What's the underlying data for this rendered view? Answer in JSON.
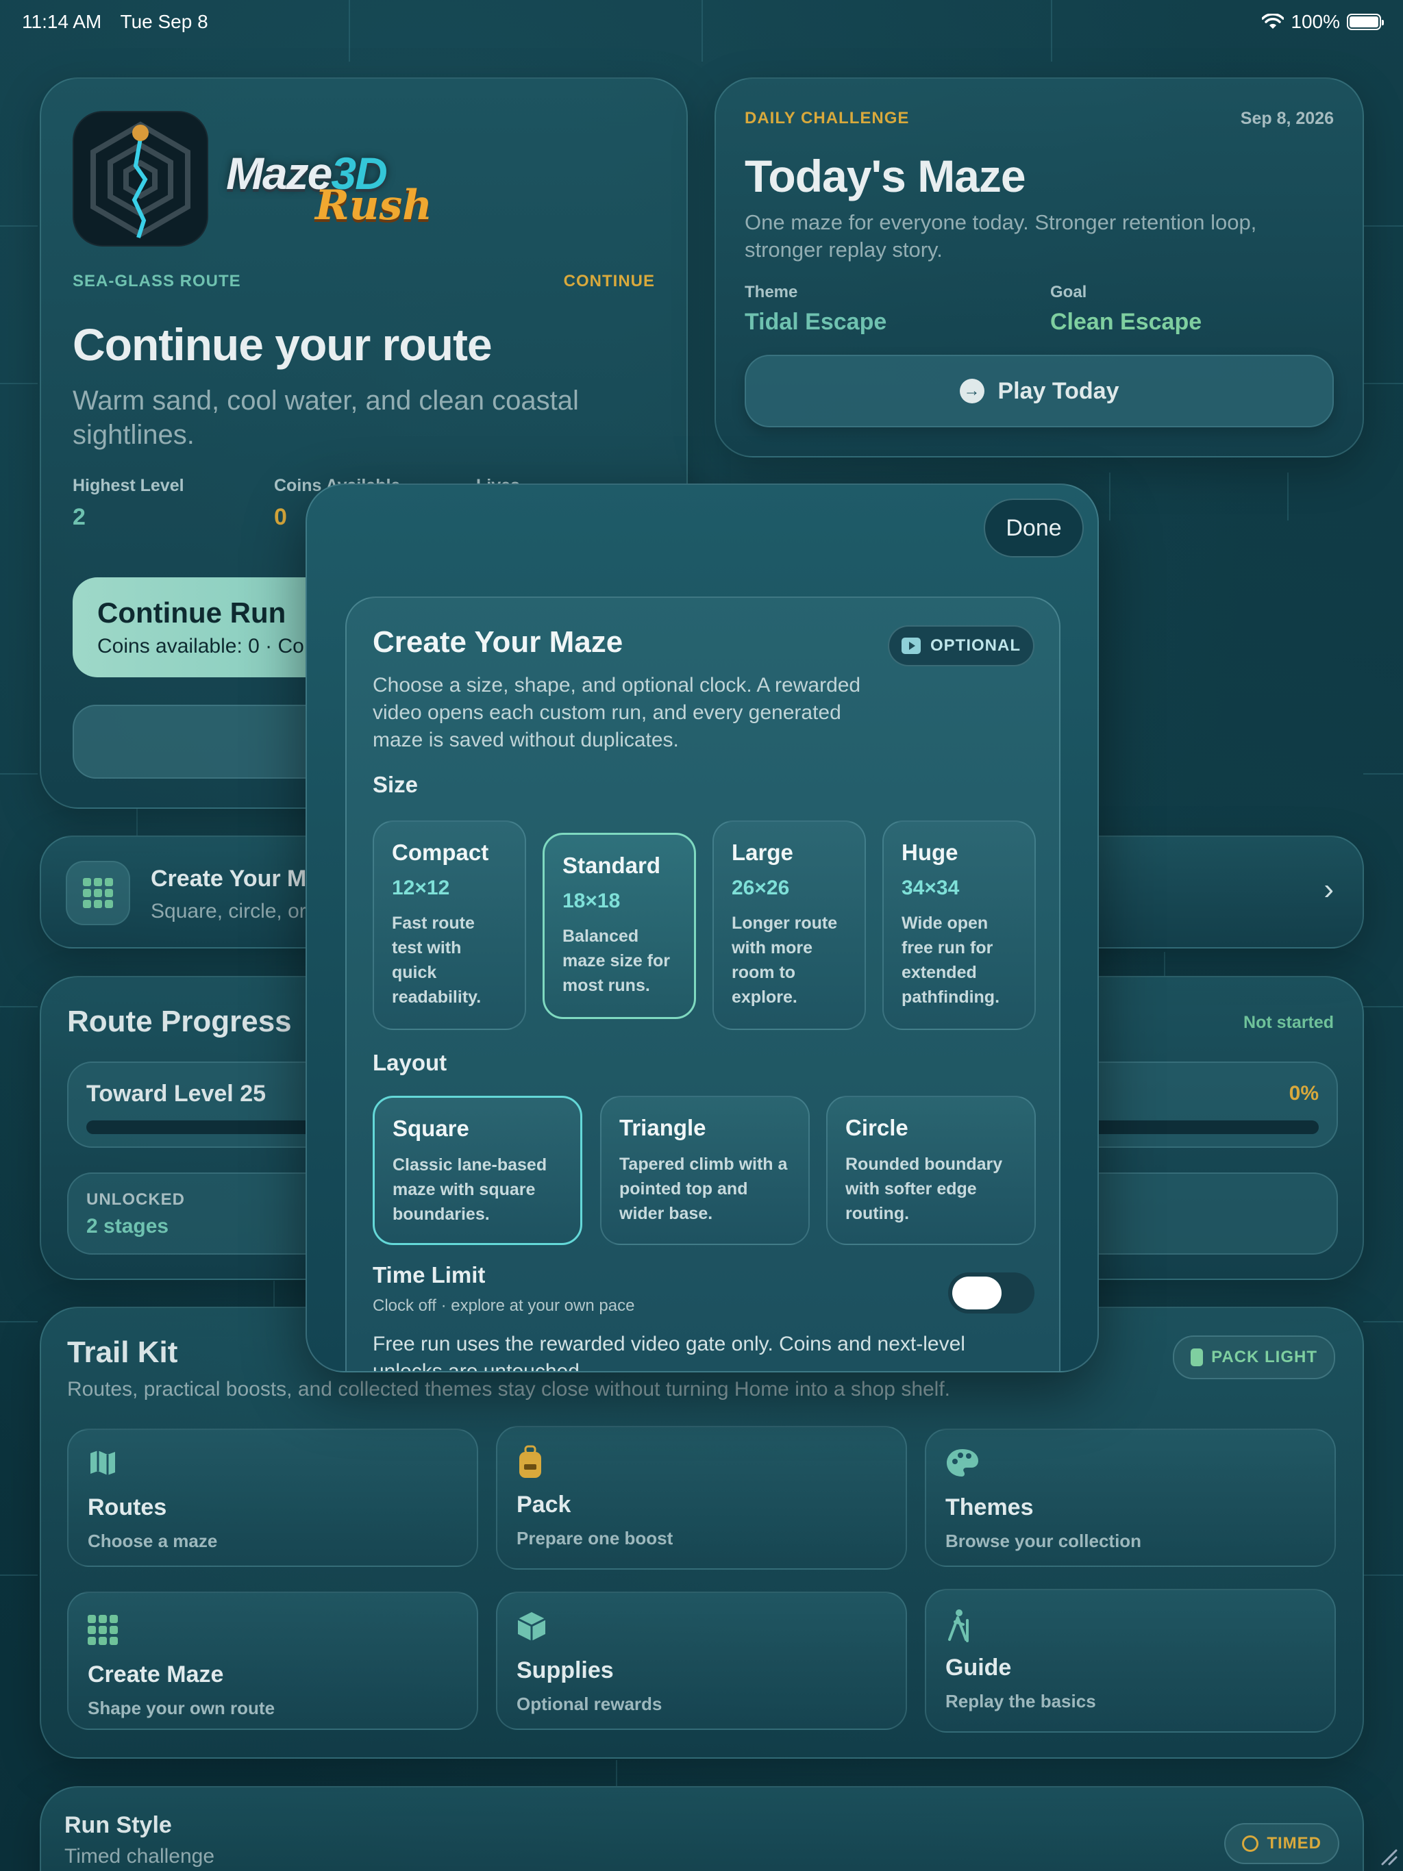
{
  "status": {
    "time": "11:14 AM",
    "date": "Tue Sep 8",
    "battery": "100%"
  },
  "continue_card": {
    "logo": {
      "maze": "Maze",
      "three_d": "3D",
      "rush": "Rush"
    },
    "route_name": "SEA-GLASS ROUTE",
    "continue_label": "CONTINUE",
    "title": "Continue your route",
    "subtitle": "Warm sand, cool water, and clean coastal sightlines.",
    "stats": [
      {
        "label": "Highest Level",
        "value": "2"
      },
      {
        "label": "Coins Available",
        "value": "0"
      },
      {
        "label": "Lives",
        "value": ""
      }
    ],
    "primary_button": {
      "title": "Continue Run",
      "subtitle": "Coins available: 0 · Co"
    }
  },
  "daily_card": {
    "eyebrow": "DAILY CHALLENGE",
    "date": "Sep 8, 2026",
    "title": "Today's Maze",
    "description": "One maze for everyone today. Stronger retention loop, stronger replay story.",
    "theme_label": "Theme",
    "theme_value": "Tidal Escape",
    "goal_label": "Goal",
    "goal_value": "Clean Escape",
    "play_button": "Play Today"
  },
  "create_row": {
    "title": "Create Your M",
    "subtitle": "Square, circle, or"
  },
  "route_progress": {
    "title": "Route Progress",
    "status": "Not started",
    "toward_label": "Toward Level 25",
    "percent": "0%",
    "progress": 0,
    "unlocked_label": "UNLOCKED",
    "unlocked_value": "2 stages"
  },
  "trail_kit": {
    "title": "Trail Kit",
    "subtitle": "Routes, practical boosts, and collected themes stay close without turning Home into a shop shelf.",
    "pill": "PACK LIGHT",
    "tiles": [
      {
        "title": "Routes",
        "subtitle": "Choose a maze",
        "icon": "map-icon"
      },
      {
        "title": "Pack",
        "subtitle": "Prepare one boost",
        "icon": "backpack-icon"
      },
      {
        "title": "Themes",
        "subtitle": "Browse your collection",
        "icon": "palette-icon"
      },
      {
        "title": "Create Maze",
        "subtitle": "Shape your own route",
        "icon": "grid-icon"
      },
      {
        "title": "Supplies",
        "subtitle": "Optional rewards",
        "icon": "cube-icon"
      },
      {
        "title": "Guide",
        "subtitle": "Replay the basics",
        "icon": "hiker-icon"
      }
    ]
  },
  "run_style": {
    "title": "Run Style",
    "subtitle": "Timed challenge",
    "pill": "TIMED"
  },
  "sheet": {
    "done": "Done",
    "title": "Create Your Maze",
    "optional": "OPTIONAL",
    "description": "Choose a size, shape, and optional clock. A rewarded video opens each custom run, and every generated maze is saved without duplicates.",
    "size_title": "Size",
    "sizes": [
      {
        "title": "Compact",
        "dims": "12×12",
        "desc": "Fast route test with quick readability."
      },
      {
        "title": "Standard",
        "dims": "18×18",
        "desc": "Balanced maze size for most runs."
      },
      {
        "title": "Large",
        "dims": "26×26",
        "desc": "Longer route with more room to explore."
      },
      {
        "title": "Huge",
        "dims": "34×34",
        "desc": "Wide open free run for extended pathfinding."
      }
    ],
    "selected_size": "Standard",
    "layout_title": "Layout",
    "layouts": [
      {
        "title": "Square",
        "desc": "Classic lane-based maze with square boundaries."
      },
      {
        "title": "Triangle",
        "desc": "Tapered climb with a pointed top and wider base."
      },
      {
        "title": "Circle",
        "desc": "Rounded boundary with softer edge routing."
      }
    ],
    "selected_layout": "Square",
    "time_title": "Time Limit",
    "time_sub": "Clock off · explore at your own pace",
    "time_enabled": false,
    "footer": "Free run uses the rewarded video gate only. Coins and next-level unlocks are untouched."
  },
  "colors": {
    "accent_gold": "#d9a93c",
    "accent_teal": "#6fc2b0",
    "accent_cyan": "#7fe0d8"
  }
}
